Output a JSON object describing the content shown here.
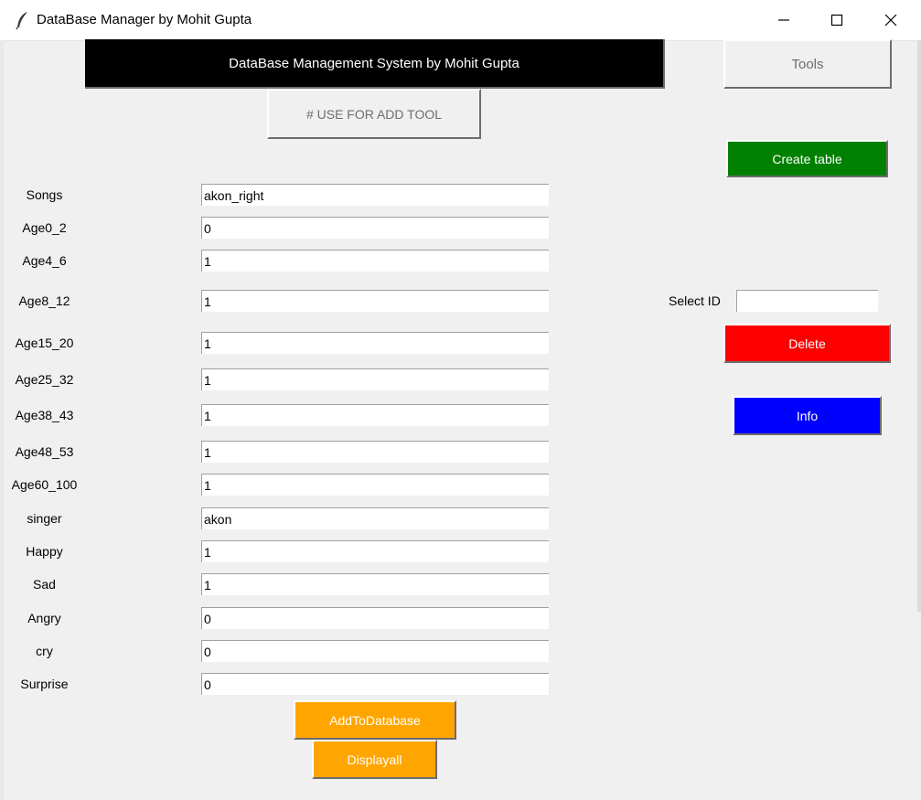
{
  "window": {
    "title": "DataBase Manager by Mohit Gupta"
  },
  "header": {
    "banner": "DataBase Management System by Mohit Gupta",
    "tools_label": "Tools",
    "use_for_add_label": "# USE FOR ADD TOOL"
  },
  "actions": {
    "create_table": "Create table",
    "select_id_label": "Select ID",
    "select_id_value": "",
    "delete": "Delete",
    "info": "Info",
    "add_to_database": "AddToDatabase",
    "display_all": "Displayall"
  },
  "fields": [
    {
      "label": "Songs",
      "value": "akon_right"
    },
    {
      "label": "Age0_2",
      "value": "0"
    },
    {
      "label": "Age4_6",
      "value": "1"
    },
    {
      "label": "Age8_12",
      "value": "1"
    },
    {
      "label": "Age15_20",
      "value": "1"
    },
    {
      "label": "Age25_32",
      "value": "1"
    },
    {
      "label": "Age38_43",
      "value": "1"
    },
    {
      "label": "Age48_53",
      "value": "1"
    },
    {
      "label": "Age60_100",
      "value": "1"
    },
    {
      "label": "singer",
      "value": "akon"
    },
    {
      "label": "Happy",
      "value": "1"
    },
    {
      "label": "Sad",
      "value": "1"
    },
    {
      "label": "Angry",
      "value": "0"
    },
    {
      "label": "cry",
      "value": "0"
    },
    {
      "label": "Surprise",
      "value": "0"
    }
  ],
  "colors": {
    "banner_bg": "#000000",
    "create_bg": "#008000",
    "delete_bg": "#ff0000",
    "info_bg": "#0000ff",
    "add_bg": "#ffa500"
  }
}
